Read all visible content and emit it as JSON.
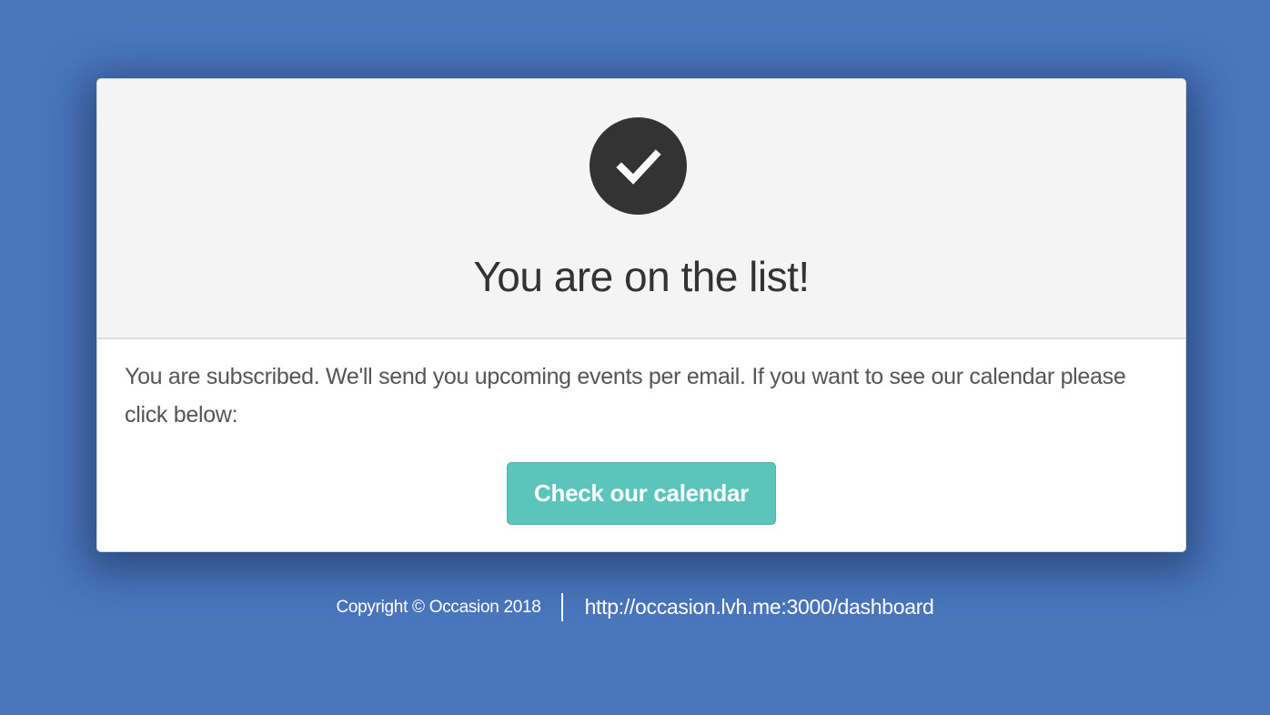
{
  "card": {
    "icon": "check-circle-icon",
    "title": "You are on the list!",
    "message": "You are subscribed. We'll send you upcoming events per email. If you want to see our calendar please click below:",
    "button_label": "Check our calendar"
  },
  "footer": {
    "copyright": "Copyright © Occasion 2018",
    "link": "http://occasion.lvh.me:3000/dashboard"
  },
  "colors": {
    "background": "#4a76bd",
    "button": "#5bc5bc",
    "icon_circle": "#333333"
  }
}
